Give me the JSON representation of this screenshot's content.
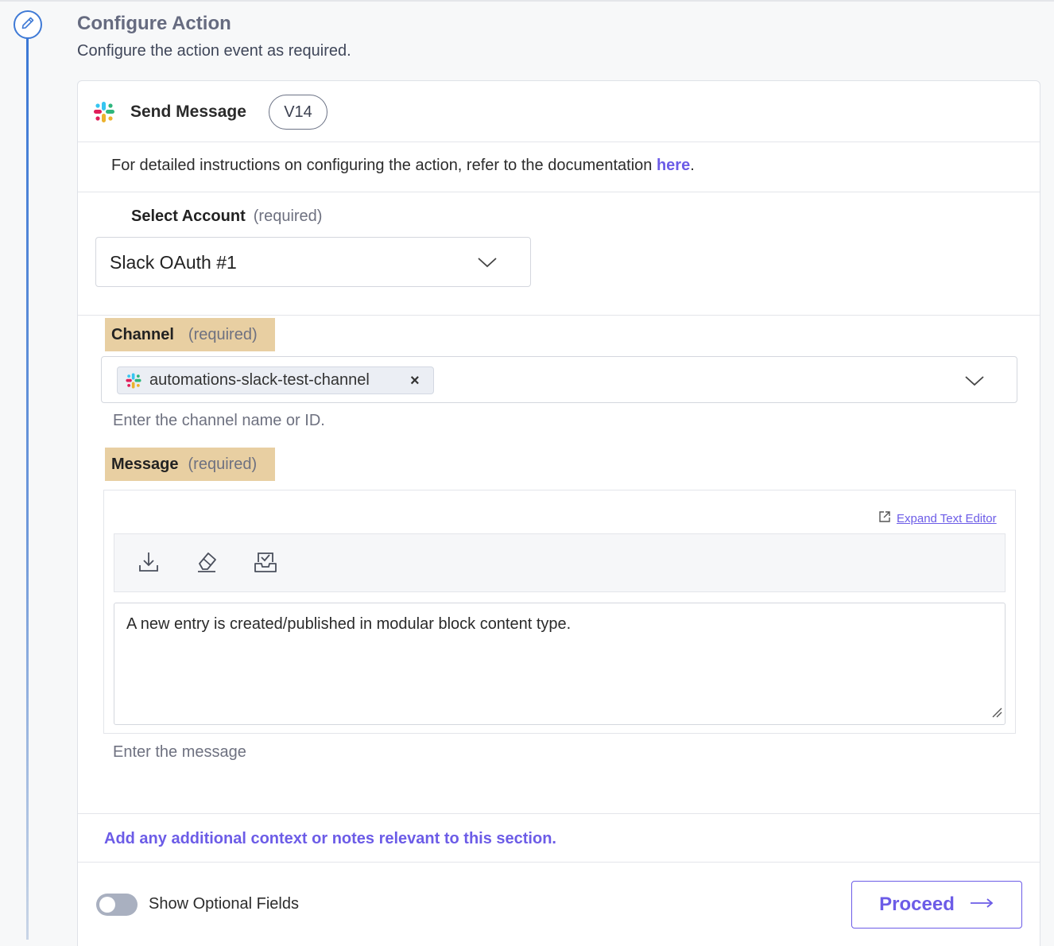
{
  "step": {
    "title": "Configure Action",
    "subtitle": "Configure the action event as required.",
    "icon": "pencil-icon"
  },
  "action": {
    "name": "Send Message",
    "version": "V14",
    "app_icon": "slack-logo-icon"
  },
  "documentation": {
    "text": "For detailed instructions on configuring the action, refer to the documentation ",
    "link_text": "here",
    "suffix": "."
  },
  "account": {
    "label": "Select Account",
    "required_text": "(required)",
    "selected_value": "Slack OAuth #1"
  },
  "channel": {
    "label": "Channel",
    "required_text": "(required)",
    "selected_chip": "automations-slack-test-channel",
    "chip_remove": "×",
    "help_text": "Enter the channel name or ID."
  },
  "message": {
    "label": "Message",
    "required_text": "(required)",
    "expand_link": "Expand Text Editor",
    "toolbar_icons": [
      "download-icon",
      "eraser-icon",
      "inbox-check-icon"
    ],
    "value": "A new entry is created/published in modular block content type.",
    "help_text": "Enter the message"
  },
  "notes": {
    "text": "Add any additional context or notes relevant to this section."
  },
  "footer": {
    "toggle_label": "Show Optional Fields",
    "toggle_on": false,
    "proceed_label": "Proceed"
  },
  "colors": {
    "accent": "#6c5ce7",
    "timeline": "#3b78d6",
    "highlight": "#e8cfa2"
  }
}
